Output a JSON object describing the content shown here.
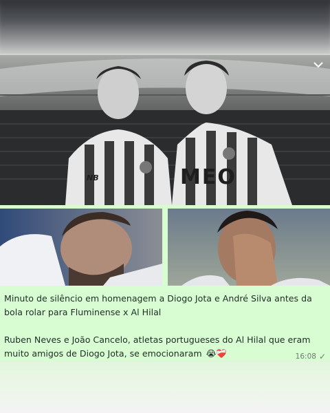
{
  "message": {
    "caption_line1": "Minuto de silêncio em homenagem a Diogo Jota e André Silva antes da bola rolar para Fluminense x Al Hilal",
    "caption_line2": "Ruben Neves e João Cancelo, atletas portugueses do Al Hilal que eram muito amigos de Diogo Jota, se emocionaram",
    "caption_emojis": "😭❤️‍🩹",
    "time": "16:08",
    "status_icon": "single-check-icon",
    "shirt_sponsor": "MEO",
    "shirt_brand": "NB"
  },
  "colors": {
    "bubble": "#d9fdd3",
    "text": "#1f2c25",
    "meta": "#6b7a70"
  }
}
